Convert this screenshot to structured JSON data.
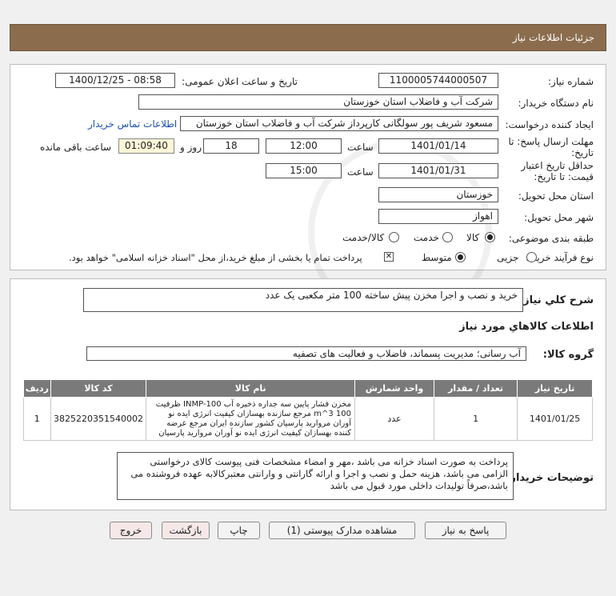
{
  "header": {
    "title": "جزئیات اطلاعات نیاز"
  },
  "form": {
    "need_number": {
      "label": "شماره نیاز:",
      "value": "1100005744000507"
    },
    "announce_date": {
      "label": "تاریخ و ساعت اعلان عمومی:",
      "value": "1400/12/25 - 08:58"
    },
    "buyer_org": {
      "label": "نام دستگاه خریدار:",
      "value": "شرکت آب و فاضلاب استان خوزستان"
    },
    "requester": {
      "label": "ایجاد کننده درخواست:",
      "value": "مسعود شریف پور سولگانی کارپرداز شرکت آب و فاضلاب استان خوزستان",
      "contact_link": "اطلاعات تماس خریدار"
    },
    "reply_deadline": {
      "label_line1": "مهلت ارسال پاسخ: تا",
      "label_line2": "تاریخ:",
      "date": "1401/01/14",
      "time_label": "ساعت",
      "time": "12:00",
      "days": "18",
      "days_label": "روز و",
      "remaining": "01:09:40",
      "remaining_label": "ساعت باقی مانده"
    },
    "price_validity": {
      "label_line1": "حداقل تاریخ اعتبار",
      "label_line2": "قیمت: تا تاریخ:",
      "date": "1401/01/31",
      "time_label": "ساعت",
      "time": "15:00"
    },
    "province": {
      "label": "استان محل تحویل:",
      "value": "خوزستان"
    },
    "city": {
      "label": "شهر محل تحویل:",
      "value": "اهواز"
    },
    "category": {
      "label": "طبقه بندی موضوعی:",
      "options": [
        "کالا",
        "خدمت",
        "کالا/خدمت"
      ],
      "selected": "کالا"
    },
    "process_type": {
      "label": "نوع فرآیند خرید :",
      "options": [
        "جزیی",
        "متوسط"
      ],
      "selected": "متوسط",
      "note": "پرداخت تمام یا بخشی از مبلغ خرید،از محل \"اسناد خزانه اسلامی\" خواهد بود."
    }
  },
  "summary": {
    "label": "شرح کلي نياز:",
    "value": "خرید و نصب و اجرا مخزن پیش ساخته 100 متر مکعبی یک عدد",
    "goods_info_title": "اطلاعات کالاهاي مورد نياز",
    "group_label": "گروه کالا:",
    "group_value": "آب رسانی؛ مدیریت پسماند، فاضلاب و فعالیت های تصفیه"
  },
  "table": {
    "headers": [
      "ردیف",
      "کد کالا",
      "نام کالا",
      "واحد شمارش",
      "تعداد / مقدار",
      "تاریخ نیاز"
    ],
    "rows": [
      {
        "row": "1",
        "code": "3825220351540002",
        "name": "مخزن فشار پایین سه جداره ذخیره آب INMP-100 ظرفیت 100 m^3 مرجع سازنده بهسازان کیفیت انرژی ایده نو آوران مروارید پارسیان کشور سازنده ایران مرجع عرضه کننده بهسازان کیفیت انرژی ایده نو آوران مروارید پارسیان",
        "unit": "عدد",
        "qty": "1",
        "date": "1401/01/25"
      }
    ]
  },
  "buyer_notes": {
    "label": "توضیحات خریدار:",
    "value": "پرداخت به صورت اسناد خزانه می باشد ،مهر و امضاء مشخصات فنی پیوست کالای درخواستی الزامی می باشد، هزینه حمل و نصب و اجرا و ارائه گارانتی و وارانتی معتبرکالابه عهده فروشنده می باشد،صرفاً تولیدات داخلی مورد قبول می باشد"
  },
  "buttons": {
    "reply": "پاسخ به نیاز",
    "attachments": "مشاهده مدارک پیوستی (1)",
    "print": "چاپ",
    "back": "بازگشت",
    "exit": "خروج"
  },
  "watermark": {
    "text": "ParsNamadData"
  }
}
